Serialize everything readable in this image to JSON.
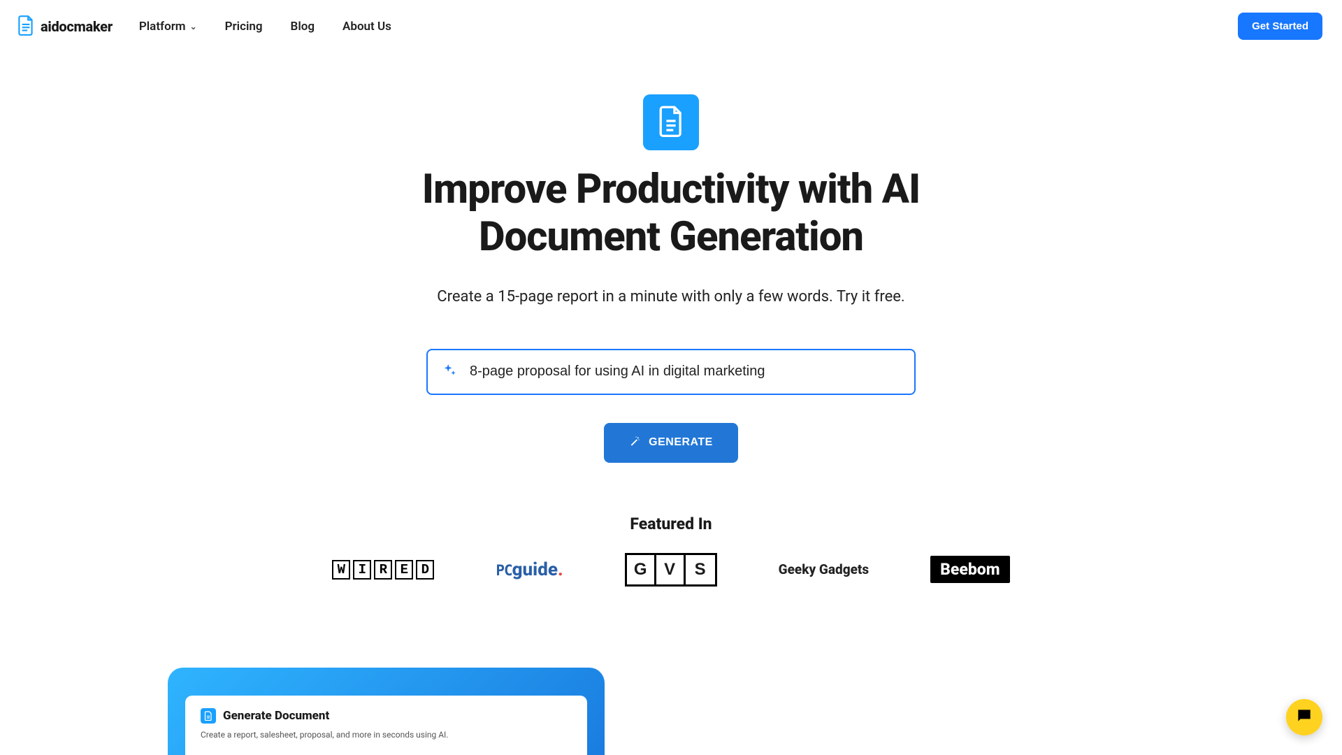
{
  "logo": {
    "text": "aidocmaker"
  },
  "nav": {
    "platform": "Platform",
    "pricing": "Pricing",
    "blog": "Blog",
    "about": "About Us"
  },
  "cta": {
    "get_started": "Get Started"
  },
  "hero": {
    "title": "Improve Productivity with AI Document Generation",
    "subtitle": "Create a 15-page report in a minute with only a few words. Try it free.",
    "prompt_value": "8-page proposal for using AI in digital marketing",
    "generate_label": "GENERATE"
  },
  "featured": {
    "title": "Featured In",
    "items": {
      "wired": "WIRED",
      "pcguide_pc": "PC",
      "pcguide_guide": "guide",
      "gvs": "GVS",
      "geeky": "Geeky Gadgets",
      "beebom": "Beebom"
    }
  },
  "demo": {
    "title": "Generate Document",
    "subtitle": "Create a report, salesheet, proposal, and more in seconds using AI."
  }
}
